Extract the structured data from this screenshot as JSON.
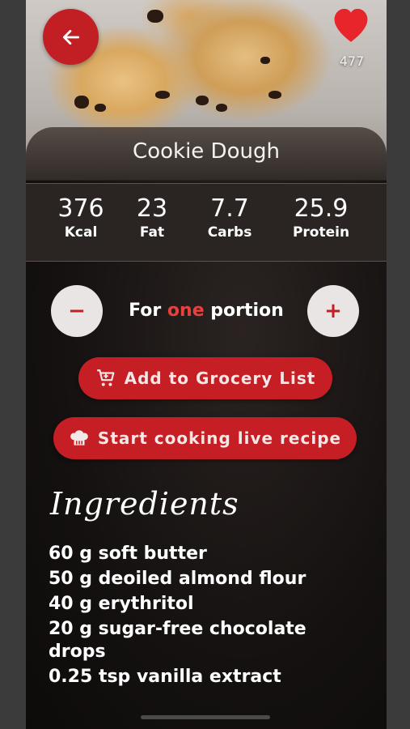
{
  "recipe": {
    "title": "Cookie Dough",
    "likes": "477"
  },
  "nutrition": [
    {
      "value": "376",
      "label": "Kcal"
    },
    {
      "value": "23",
      "label": "Fat"
    },
    {
      "value": "7.7",
      "label": "Carbs"
    },
    {
      "value": "25.9",
      "label": "Protein"
    }
  ],
  "portion": {
    "prefix": "For ",
    "count": "one",
    "suffix": " portion",
    "minus_symbol": "−",
    "plus_symbol": "+"
  },
  "actions": {
    "grocery_label": "Add to Grocery List",
    "cook_label": "Start cooking live recipe"
  },
  "ingredients": {
    "heading": "Ingredients",
    "items": [
      "60 g soft butter",
      "50 g deoiled almond flour",
      "40 g erythritol",
      "20 g sugar-free chocolate drops",
      "0.25 tsp vanilla extract"
    ]
  },
  "colors": {
    "accent": "#c21f24",
    "highlight": "#e8403c",
    "heart": "#e8252b"
  },
  "icons": [
    "back-arrow-icon",
    "heart-icon",
    "cart-icon",
    "chef-hat-icon",
    "minus-icon",
    "plus-icon"
  ]
}
